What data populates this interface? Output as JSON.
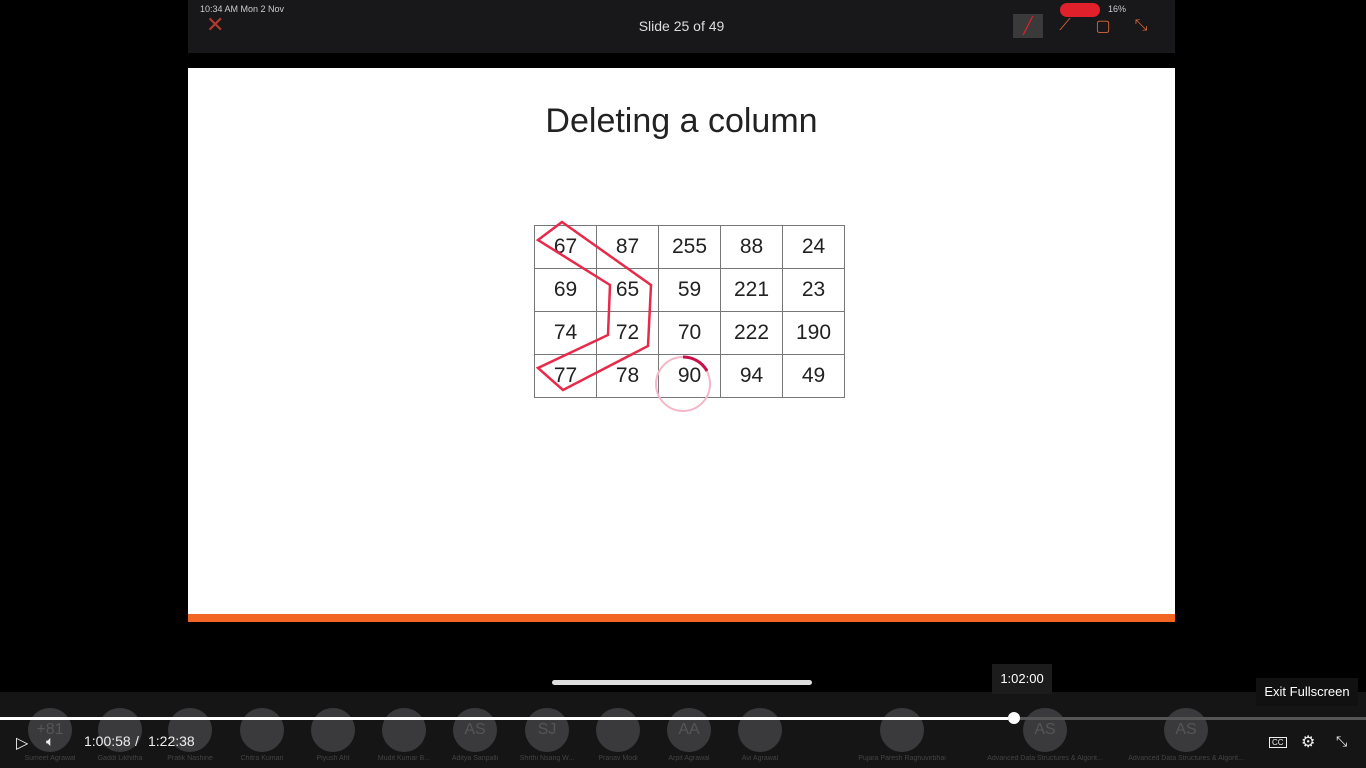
{
  "topbar": {
    "status_time": "10:34 AM  Mon 2 Nov",
    "battery": "16%",
    "slide_counter": "Slide 25 of 49",
    "icons": [
      "close-icon",
      "pen-icon",
      "lasso-icon",
      "window-icon",
      "collapse-icon"
    ]
  },
  "slide": {
    "title": "Deleting a column",
    "grid": [
      [
        "67",
        "87",
        "255",
        "88",
        "24"
      ],
      [
        "69",
        "65",
        "59",
        "221",
        "23"
      ],
      [
        "74",
        "72",
        "70",
        "222",
        "190"
      ],
      [
        "77",
        "78",
        "90",
        "94",
        "49"
      ]
    ],
    "accent": "#f26522",
    "annotation_color": "#e8294a"
  },
  "participants": [
    {
      "initials": "+81",
      "name": "Sumeet Agrawal"
    },
    {
      "initials": "",
      "name": "Gaddi Likhitha"
    },
    {
      "initials": "",
      "name": "Pratik Nashine"
    },
    {
      "initials": "",
      "name": "Chitra Kumari"
    },
    {
      "initials": "",
      "name": "Piyush Aht"
    },
    {
      "initials": "",
      "name": "Mudit Kumar B..."
    },
    {
      "initials": "AS",
      "name": "Aditya Sanpalli"
    },
    {
      "initials": "SJ",
      "name": "Shrthi Nsang W..."
    },
    {
      "initials": "",
      "name": "Pranav Modi"
    },
    {
      "initials": "AA",
      "name": "Arpit Agrawal"
    },
    {
      "initials": "",
      "name": "Avi Agrawal"
    },
    {
      "initials": "",
      "name": "Pujara Paresh Raghuvirbhai"
    },
    {
      "initials": "AS",
      "name": "Advanced Data Structures & Algorit..."
    },
    {
      "initials": "AS",
      "name": "Advanced Data Structures & Algorit..."
    }
  ],
  "player": {
    "current_time": "1:00:58",
    "separator": "/",
    "duration": "1:22:38",
    "progress_fraction": 0.738,
    "hover_time": "1:02:00",
    "exit_fullscreen_tooltip": "Exit Fullscreen",
    "cc_label": "CC"
  }
}
